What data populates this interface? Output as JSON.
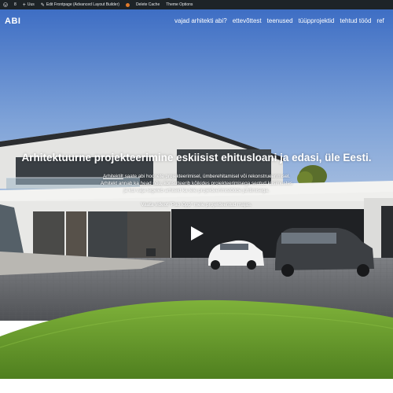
{
  "adminbar": {
    "site_count": "8",
    "new_label": "Uus",
    "edit_label": "Edit Frontpage (Advanced Layout Builder)",
    "cache_label": "Delete Cache",
    "theme_label": "Theme Options"
  },
  "header": {
    "logo": "ABI",
    "nav": [
      "vajad arhitekti abi?",
      "ettevõttest",
      "teenused",
      "tüüpprojektid",
      "tehtud tööd",
      "ref"
    ]
  },
  "hero": {
    "title": "Arhitektuurne projekteerimine eskiisist ehitusloani ja edasi, üle Eesti.",
    "body_link": "Arhitektilt",
    "body_line1_rest": " saate abi hoonete projekteerimisel, ümberehitamisel või rekonstrueerimisel.",
    "body_line2": "Arhitekt annab ka head nõu, konsulteerib kõikides projekteerimisega seotud küsimustes",
    "body_line3": "ja kui vaja tegeleb arhitekt ka teie projekteerimistööde juhtimisega.",
    "video_note": "Vaata videot \"Pao lõpp\" meie projekteeritud majas."
  },
  "colors": {
    "adminbar_bg": "#1d2327",
    "accent_dot": "#e07a2c",
    "sky_top": "#3e6ec4",
    "lawn": "#6a9e2c"
  },
  "icons": {
    "wp_logo": "wordpress-icon",
    "plus": "plus-icon",
    "edit": "pencil-icon",
    "play": "play-icon"
  }
}
